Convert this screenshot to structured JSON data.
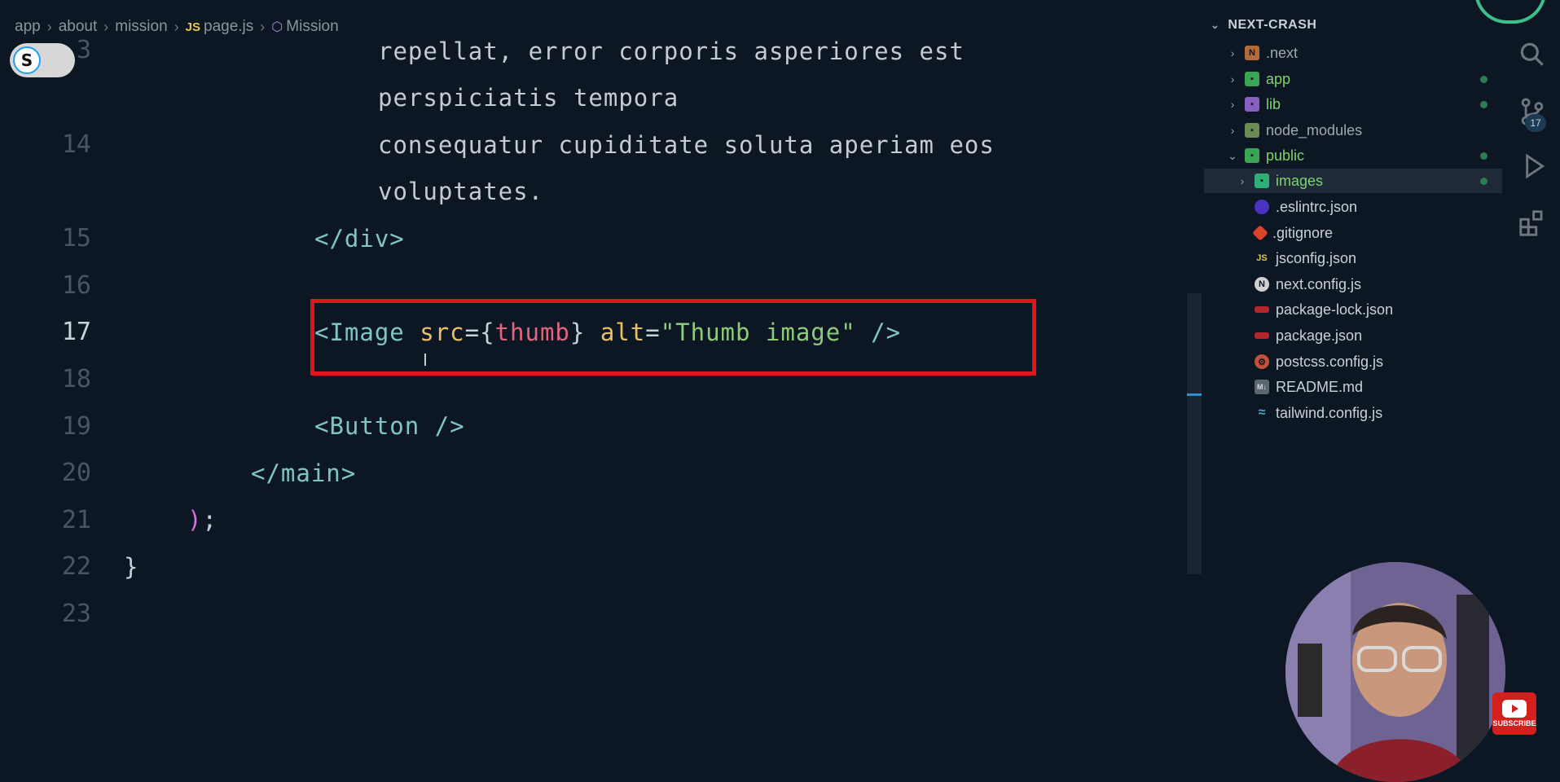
{
  "breadcrumb": {
    "items": [
      "app",
      "about",
      "mission"
    ],
    "file_icon": "JS",
    "file": "page.js",
    "symbol": "Mission"
  },
  "toggle": {
    "label": "S"
  },
  "editor": {
    "line_numbers": [
      "3",
      "14",
      "15",
      "16",
      "17",
      "18",
      "19",
      "20",
      "21",
      "22",
      "23"
    ],
    "active_line": "17",
    "lines": {
      "l_a": "repellat, error corporis asperiores est",
      "l_b": "perspiciatis tempora",
      "l_c": "consequatur cupiditate soluta aperiam eos",
      "l_d": "voluptates.",
      "l15": "</div>",
      "l17": {
        "open": "<",
        "tag": "Image",
        "attr1": "src",
        "eq1": "=",
        "brace_open": "{",
        "var": "thumb",
        "brace_close": "}",
        "attr2": "alt",
        "eq2": "=",
        "str": "\"Thumb image\"",
        "close": "/>"
      },
      "l19": "<Button />",
      "l20": "</main>",
      "l21_paren": ")",
      "l21_semi": ";",
      "l22": "}"
    }
  },
  "explorer": {
    "title": "NEXT-CRASH",
    "items": [
      {
        "name": ".next",
        "icon": "folder-next-icon",
        "color": "#a0a8b1"
      },
      {
        "name": "app",
        "icon": "folder-app-icon",
        "color": "#7ed36f",
        "dot": true
      },
      {
        "name": "lib",
        "icon": "folder-lib-icon",
        "color": "#7ed36f",
        "dot": true
      },
      {
        "name": "node_modules",
        "icon": "folder-node-icon",
        "color": "#a0a8b1"
      },
      {
        "name": "public",
        "icon": "folder-public-icon",
        "color": "#7ed36f",
        "dot": true
      },
      {
        "name": "images",
        "icon": "folder-images-icon",
        "color": "#7ed36f",
        "dot": true
      },
      {
        "name": ".eslintrc.json",
        "icon": "eslint-icon",
        "color": "#c9d1d9"
      },
      {
        "name": ".gitignore",
        "icon": "git-icon",
        "color": "#c9d1d9"
      },
      {
        "name": "jsconfig.json",
        "icon": "js-icon",
        "color": "#c9d1d9"
      },
      {
        "name": "next.config.js",
        "icon": "next-icon",
        "color": "#c9d1d9"
      },
      {
        "name": "package-lock.json",
        "icon": "npm-icon",
        "color": "#c9d1d9"
      },
      {
        "name": "package.json",
        "icon": "npm-icon",
        "color": "#c9d1d9"
      },
      {
        "name": "postcss.config.js",
        "icon": "postcss-icon",
        "color": "#c9d1d9"
      },
      {
        "name": "README.md",
        "icon": "markdown-icon",
        "color": "#c9d1d9"
      },
      {
        "name": "tailwind.config.js",
        "icon": "tailwind-icon",
        "color": "#c9d1d9"
      }
    ]
  },
  "activity": {
    "scm_badge": "17"
  },
  "overlay": {
    "subscribe": "SUBSCRIBE"
  }
}
